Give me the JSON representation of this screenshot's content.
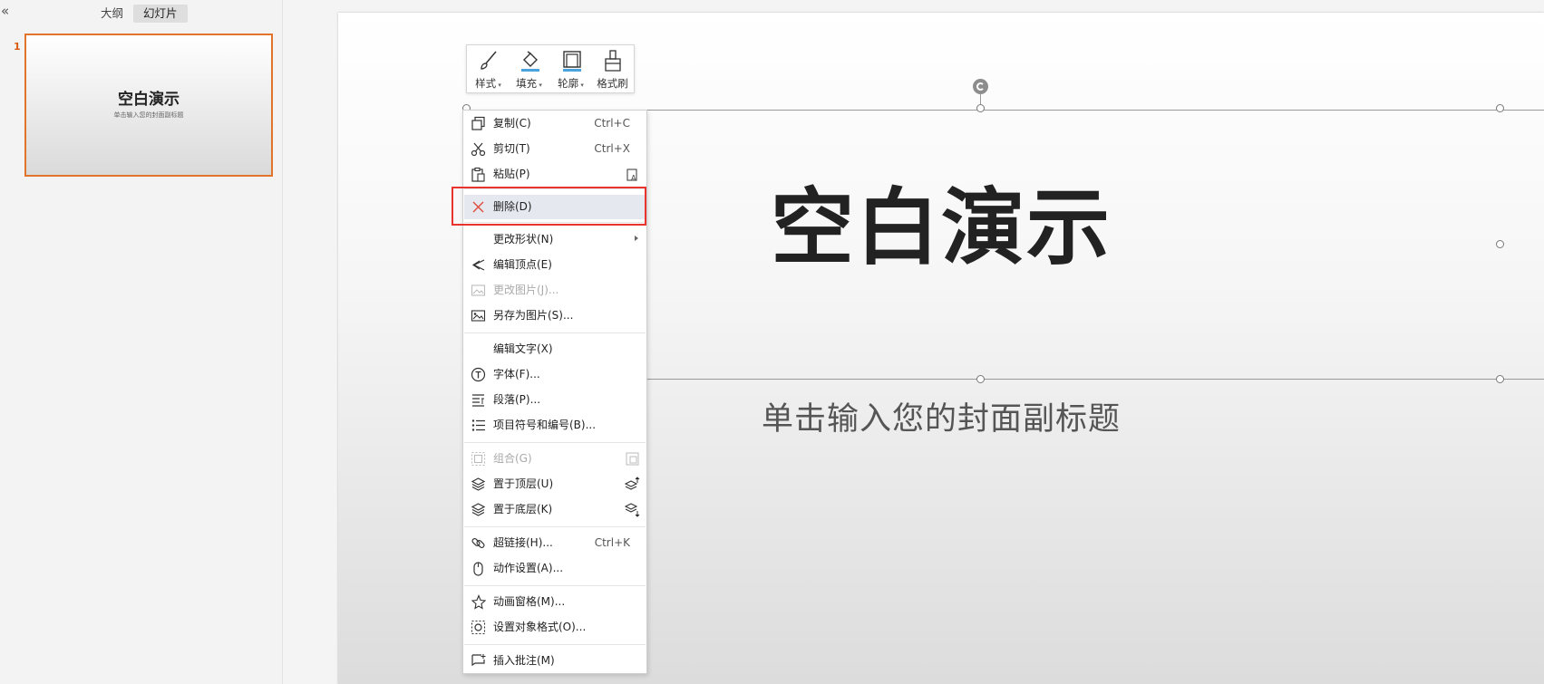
{
  "left_panel": {
    "tabs": {
      "outline": "大纲",
      "slides": "幻灯片"
    },
    "slide_number": "1",
    "thumbnail": {
      "title": "空白演示",
      "subtitle": "单击输入您的封面副标题"
    }
  },
  "slide": {
    "title": "空白演示",
    "subtitle": "单击输入您的封面副标题"
  },
  "mini_toolbar": {
    "style": "样式",
    "fill": "填充",
    "outline": "轮廓",
    "format_painter": "格式刷"
  },
  "context_menu": {
    "copy": {
      "label": "复制(C)",
      "shortcut": "Ctrl+C"
    },
    "cut": {
      "label": "剪切(T)",
      "shortcut": "Ctrl+X"
    },
    "paste": {
      "label": "粘贴(P)"
    },
    "delete": {
      "label": "删除(D)"
    },
    "change_shape": {
      "label": "更改形状(N)"
    },
    "edit_points": {
      "label": "编辑顶点(E)"
    },
    "change_picture": {
      "label": "更改图片(J)..."
    },
    "save_as_picture": {
      "label": "另存为图片(S)..."
    },
    "edit_text": {
      "label": "编辑文字(X)"
    },
    "font": {
      "label": "字体(F)..."
    },
    "paragraph": {
      "label": "段落(P)..."
    },
    "bullets": {
      "label": "项目符号和编号(B)..."
    },
    "group": {
      "label": "组合(G)"
    },
    "bring_to_front": {
      "label": "置于顶层(U)"
    },
    "send_to_back": {
      "label": "置于底层(K)"
    },
    "hyperlink": {
      "label": "超链接(H)...",
      "shortcut": "Ctrl+K"
    },
    "action_settings": {
      "label": "动作设置(A)..."
    },
    "animation_pane": {
      "label": "动画窗格(M)..."
    },
    "format_object": {
      "label": "设置对象格式(O)..."
    },
    "insert_comment": {
      "label": "插入批注(M)"
    }
  },
  "colors": {
    "accent_orange": "#e0742b",
    "highlight_red": "#e8332f",
    "delete_icon_red": "#e04a3b"
  }
}
